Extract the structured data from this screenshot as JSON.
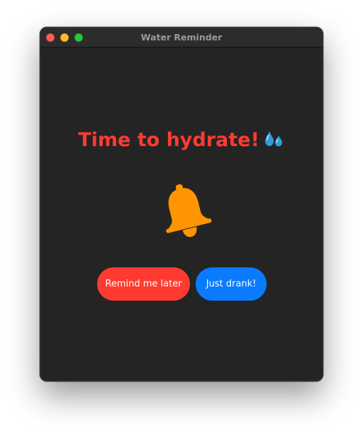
{
  "window": {
    "title": "Water Reminder"
  },
  "reminder": {
    "headline": "Time to hydrate!",
    "headline_icon": "sweat-droplets-emoji",
    "bell_icon": "bell-icon",
    "colors": {
      "headline": "#ff3b30",
      "bell": "#ff9500",
      "background": "#242424"
    }
  },
  "actions": {
    "remind_later_label": "Remind me later",
    "just_drank_label": "Just drank!",
    "colors": {
      "remind_later": "#ff3b30",
      "just_drank": "#0a7aff"
    }
  }
}
